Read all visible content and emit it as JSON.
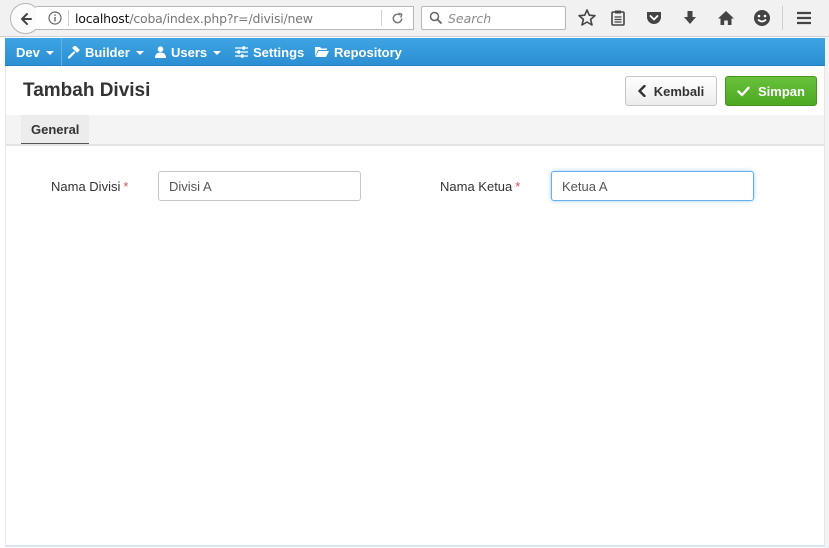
{
  "browser": {
    "url_host": "localhost",
    "url_path": "/coba/index.php?r=/divisi/new",
    "search_placeholder": "Search"
  },
  "navbar": {
    "items": [
      {
        "label": "Dev",
        "icon": "",
        "has_caret": true
      },
      {
        "label": "Builder",
        "icon": "hammer-icon",
        "has_caret": true
      },
      {
        "label": "Users",
        "icon": "user-icon",
        "has_caret": true
      },
      {
        "label": "Settings",
        "icon": "sliders-icon",
        "has_caret": false
      },
      {
        "label": "Repository",
        "icon": "folder-open-icon",
        "has_caret": false
      }
    ]
  },
  "page": {
    "title": "Tambah Divisi",
    "back_label": "Kembali",
    "save_label": "Simpan",
    "tabs": [
      {
        "label": "General",
        "active": true
      }
    ]
  },
  "form": {
    "fields": [
      {
        "label": "Nama Divisi",
        "required_mark": "*",
        "value": "Divisi A"
      },
      {
        "label": "Nama Ketua",
        "required_mark": "*",
        "value": "Ketua A"
      }
    ]
  },
  "colors": {
    "navbar": "#3399dd",
    "save_button": "#5cb52e",
    "required": "#d9534f"
  }
}
